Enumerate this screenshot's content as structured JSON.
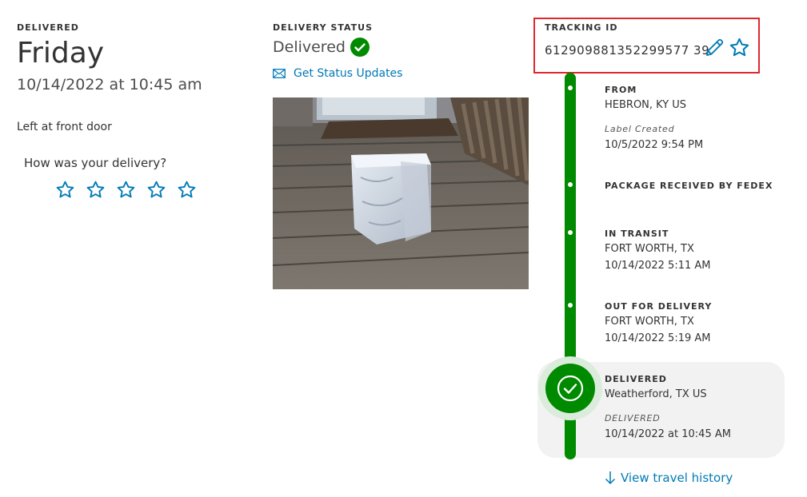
{
  "delivered_panel": {
    "label": "DELIVERED",
    "day": "Friday",
    "datetime": "10/14/2022 at 10:45 am",
    "location_note": "Left at front door",
    "rating_prompt": "How was your delivery?",
    "rating_stars": 5,
    "rating_value": 0
  },
  "status_panel": {
    "label": "DELIVERY STATUS",
    "status": "Delivered",
    "updates_link": "Get Status Updates",
    "photo_icon": "package-photo"
  },
  "tracking": {
    "label": "TRACKING ID",
    "number": "612909881352299577 39",
    "edit_icon": "pencil-icon",
    "favorite_icon": "star-icon"
  },
  "timeline": {
    "events": [
      {
        "title": "FROM",
        "line1": "HEBRON, KY US",
        "note": "Label Created",
        "line2": "10/5/2022 9:54 PM"
      },
      {
        "title": "PACKAGE RECEIVED BY FEDEX"
      },
      {
        "title": "IN TRANSIT",
        "line1": "FORT WORTH, TX",
        "line2": "10/14/2022 5:11 AM"
      },
      {
        "title": "OUT FOR DELIVERY",
        "line1": "FORT WORTH, TX",
        "line2": "10/14/2022 5:19 AM"
      },
      {
        "title": "DELIVERED",
        "line1": "Weatherford, TX US",
        "note": "DELIVERED",
        "line2": "10/14/2022 at 10:45 AM"
      }
    ],
    "history_link": "View travel history"
  },
  "colors": {
    "accent_blue": "#007ab7",
    "success_green": "#008a00",
    "highlight_red": "#e0262d"
  }
}
